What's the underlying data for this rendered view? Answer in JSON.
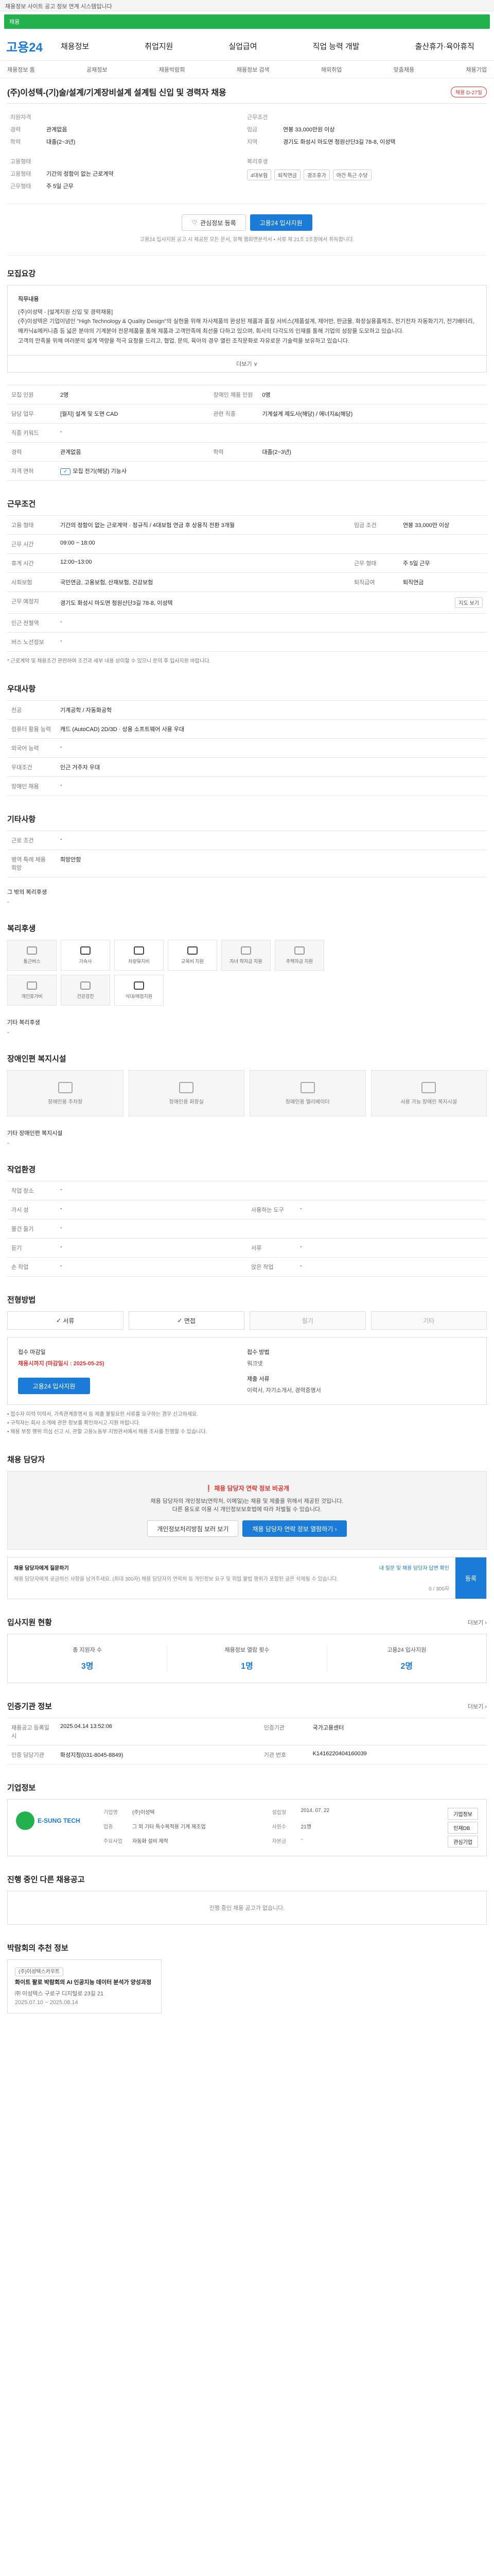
{
  "topbar": {
    "text": "채용정보 사이트 공고 정보 연계 시스템입니다"
  },
  "greenbar": {
    "label": "채용"
  },
  "header": {
    "logo": "고용24",
    "nav": [
      "채용정보",
      "취업지원",
      "실업급여",
      "직업 능력 개발",
      "출산휴가·육아휴직"
    ]
  },
  "subnav": [
    "채용정보 홈",
    "공채정보",
    "채용박람회",
    "채용정보 검색",
    "해외취업",
    "맞춤채용",
    "채용기업"
  ],
  "job": {
    "title": "(주)이성텍-(기)술/설계/기계장비설계 설계팀 신입 및 경력자 채용",
    "dday": "채용 D-27일",
    "summary_left": [
      {
        "k": "지원자격",
        "v": ""
      },
      {
        "k": "경력",
        "v": "관계없음"
      },
      {
        "k": "학력",
        "v": "대졸(2~3년)"
      }
    ],
    "summary_left2": [
      {
        "k": "고용형태",
        "v": ""
      },
      {
        "k": "고용형태",
        "v": "기간의 정함이 없는 근로계약"
      },
      {
        "k": "근무형태",
        "v": "주 5일 근무"
      }
    ],
    "summary_right": [
      {
        "k": "근무조건",
        "v": ""
      },
      {
        "k": "임금",
        "v": "연봉 33,000만원 이상"
      },
      {
        "k": "지역",
        "v": "경기도 화성시 마도면 청원산단3길 78-8, 이성텍"
      }
    ],
    "welfare_label": "복리후생",
    "welfare_tags": [
      "4대보험",
      "퇴직연금",
      "경조휴가",
      "야간 특근 수당"
    ],
    "btn_scrap": "관심정보 등록",
    "btn_apply": "고용24 입사지원",
    "note": "고용24 입사지원 공고 시 제공된 모든 문서, 유해 웹화면분석서 • 서류 제 21조 2조항에서 취득합니다."
  },
  "recruit": {
    "heading": "모집요강",
    "box_title": "직무내용",
    "box_lines": [
      "(주)이성텍 - [설계지원 신입 및 경력채용]",
      "(주)이성텍은 기업이념인 \"High Technology & Quality Design\"의 실현을 위해 자사제품의 완성된 제품과 품질 서비스(제품설계, 제어반, 판금물, 화장실용품제조, 전기전자 자동화기기, 전기배터리, 메카닉&메커니즘 등 넓은 분야의 기계분야 전문제품을 통해 제품과 고객만족에 최선을 다하고 있으며, 회사의 다각도의 인재를 통해 기업의 성장을 도모하고 있습니다.",
      "고객의 만족을 위해 여러분의 설계 역량을 적극 요청을 드리고, 협업, 문의, 육아의 경우 열린 조직문화로 자유로운 기술력을 보유하고 있습니다."
    ],
    "more": "더보기 ∨",
    "rows": [
      {
        "k": "모집 인원",
        "v": "2명",
        "k2": "장애인 채용 인원",
        "v2": "0명"
      },
      {
        "k": "담당 업무",
        "v": "[월지] 설계 및 도면 CAD",
        "k2": "관련 직종",
        "v2": "기계설계 제도사(해당) / 에너지&(해당)"
      },
      {
        "k": "직종 키워드",
        "v": "-",
        "k2": "",
        "v2": ""
      },
      {
        "k": "경력",
        "v": "관계없음",
        "k2": "학력",
        "v2": "대졸(2~3년)"
      },
      {
        "k": "자격 면허",
        "v": "모집 전기(해당) 기능사",
        "k2": "",
        "v2": ""
      }
    ]
  },
  "conditions": {
    "heading": "근무조건",
    "rows": [
      {
        "k": "고용 형태",
        "v": "기간의 정함이 없는 근로계약 · 정규직 / 4대보험 연금 후 상용직 전환 3개월",
        "k2": "임금 조건",
        "v2": "연봉 33,000만 이상"
      },
      {
        "k": "근무 시간",
        "v": "09:00 ~ 18:00",
        "k2": "",
        "v2": ""
      },
      {
        "k": "휴게 시간",
        "v": "12:00~13:00",
        "k2": "근무 형태",
        "v2": "주 5일 근무"
      },
      {
        "k": "사회보험",
        "v": "국민연금, 고용보험, 산재보험, 건강보험",
        "k2": "퇴직급여",
        "v2": "퇴직연금"
      },
      {
        "k": "근무 예정지",
        "v": "경기도 화성시 마도면 청원산단3길 78-8, 이성텍",
        "k2": "",
        "v2": ""
      },
      {
        "k": "인근 전철역",
        "v": "-",
        "k2": "",
        "v2": ""
      },
      {
        "k": "버스 노선정보",
        "v": "-",
        "k2": "",
        "v2": ""
      }
    ],
    "map_btn": "지도 보기",
    "foot": "* 근로계약 및 채용조건 관련하여 조건과 세부 내용 상이할 수 있으니 문의 후 입사지원 바랍니다."
  },
  "hire": {
    "heading": "우대사항",
    "rows": [
      {
        "k": "전공",
        "v": "기계공학 / 자동화공학"
      },
      {
        "k": "컴퓨터 활용 능력",
        "v": "캐드 (AutoCAD) 2D/3D · 상용 소프트웨어 사용 우대"
      },
      {
        "k": "외국어 능력",
        "v": "-"
      },
      {
        "k": "우대조건",
        "v": "인근 거주자 우대"
      },
      {
        "k": "장애인 채용",
        "v": "-"
      }
    ]
  },
  "etc": {
    "heading": "기타사항",
    "rows": [
      {
        "k": "근로 조건",
        "v": "-"
      },
      {
        "k": "병역 특례 채용 희망",
        "v": "희망안함"
      }
    ],
    "extra_label": "그 밖의 복리후생",
    "extra_value": "-"
  },
  "welfare": {
    "heading": "복리후생",
    "items": [
      {
        "label": "통근버스",
        "on": false
      },
      {
        "label": "기숙사",
        "on": true
      },
      {
        "label": "차량유지비",
        "on": true
      },
      {
        "label": "교육비 지원",
        "on": true
      },
      {
        "label": "자녀 학자금 지원",
        "on": false
      },
      {
        "label": "주택자금 지원",
        "on": false
      },
      {
        "label": "개인휴가비",
        "on": false
      },
      {
        "label": "건강검진",
        "on": false
      },
      {
        "label": "식대/매점지원",
        "on": true
      }
    ],
    "other_label": "기타 복리후생",
    "other_value": "-"
  },
  "disability": {
    "heading": "장애인편 복지시설",
    "items": [
      "장애인용 주차장",
      "장애인용 화장실",
      "장애인용 엘리베이터",
      "사용 가능 장애인 복지시설"
    ],
    "other_label": "기타 장애인편 복지시설",
    "other_value": "-"
  },
  "workplace": {
    "heading": "작업환경",
    "rows": [
      {
        "k": "작업 장소",
        "v": "-",
        "k2": "",
        "v2": ""
      },
      {
        "k": "가시 성",
        "v": "-",
        "k2": "사용하는 도구",
        "v2": "-"
      },
      {
        "k": "물건 들기",
        "v": "-",
        "k2": "",
        "v2": ""
      },
      {
        "k": "듣기",
        "v": "-",
        "k2": "서류",
        "v2": "-"
      },
      {
        "k": "손 작업",
        "v": "-",
        "k2": "앉은 작업",
        "v2": "-"
      }
    ]
  },
  "process": {
    "heading": "전형방법",
    "steps": [
      "서류",
      "면접",
      "필기",
      "기타"
    ],
    "deadline_label": "접수 마감일",
    "deadline_value": "채용시까지 (마감일시 : 2025-05-25)",
    "method_label": "접수 방법",
    "method_value": "워크넷",
    "doc_label": "제출 서류",
    "doc_value": "이력서, 자기소개서, 경력증명서",
    "apply_btn": "고용24 입사지원",
    "notes": [
      "• 접수자 이력 이력서, 가족관계증명서 등 제출 불필요한 서류를 요구하는 경우 신고하세요.",
      "• 구직자는 회사 소개에 관한 정보를 확인하시고 지원 바랍니다.",
      "• 채용 부정 행위 의심 신고 시, 관할 고용노동부 지방관서에서 채용 조사를 진행할 수 있습니다."
    ]
  },
  "contact": {
    "heading": "채용 담당자",
    "alert_title": "❗ 채용 담당자 연락 정보 비공개",
    "alert_line1": "채용 담당자의 개인정보(연락처, 이메일)는 채용 및 제출을 위해서 제공된 것입니다.",
    "alert_line2": "다른 용도로 이용 시 개인정보보호법에 따라 처벌될 수 있습니다.",
    "btn1": "개인정보처리방침 보러 보기",
    "btn2": "채용 담당자 연락 정보 열람하기 ›",
    "qa_label": "채용 담당자에게 질문하기",
    "qa_link": "내 질문 및 채용 담당자 답변 확인",
    "qa_placeholder": "채용 담당자에게 궁금하신 사항을 남겨주세요. (최대 300자) 채용 담당자의 연락처 등 개인정보 요구 및 취업 불법 행위가 포함된 글은 삭제될 수 있습니다.",
    "qa_count": "0 / 300자",
    "qa_btn": "등록"
  },
  "status": {
    "heading": "입사지원 현황",
    "link": "더보기 ›",
    "stats": [
      {
        "label": "총 지원자 수",
        "value": "3명"
      },
      {
        "label": "채용정보 열람 횟수",
        "value": "1명"
      },
      {
        "label": "고용24 입사지원",
        "value": "2명"
      }
    ]
  },
  "cert": {
    "heading": "인증기관 정보",
    "link": "더보기 ›",
    "rows": [
      {
        "k": "채용공고 등록일시",
        "v": "2025.04.14 13:52:06",
        "k2": "인증기관",
        "v2": "국가고용센터"
      },
      {
        "k": "인증 담당기관",
        "v": "화성지청(031-8045-8849)",
        "k2": "기관 번호",
        "v2": "K1416220404160039"
      }
    ]
  },
  "company": {
    "heading": "기업정보",
    "logo_text": "E-SUNG TECH",
    "info": [
      {
        "k": "기업명",
        "v": "(주)이성텍"
      },
      {
        "k": "설립일",
        "v": "2014. 07. 22"
      },
      {
        "k": "업종",
        "v": "그 외 기타 특수목적용 기계 제조업"
      },
      {
        "k": "사원수",
        "v": "21명"
      },
      {
        "k": "주요사업",
        "v": "자동화 설비 제작"
      },
      {
        "k": "자본금",
        "v": "-"
      }
    ],
    "btns": [
      "기업정보",
      "인재DB",
      "관심기업"
    ]
  },
  "others": {
    "heading": "진행 중인 다른 채용공고",
    "empty": "진행 중인 채용 공고가 없습니다."
  },
  "recommend": {
    "heading": "박람회의 추천 정보",
    "tag": "(주)이성텍스카우트",
    "title": "화이트 팔로 박람회의 AI 인공지능 데이터 분석가 양성과정",
    "company": "㈜ 이성텍스 구로구 디지털로 23길 21",
    "dates": "2025.07.10 ~ 2025.08.14"
  }
}
